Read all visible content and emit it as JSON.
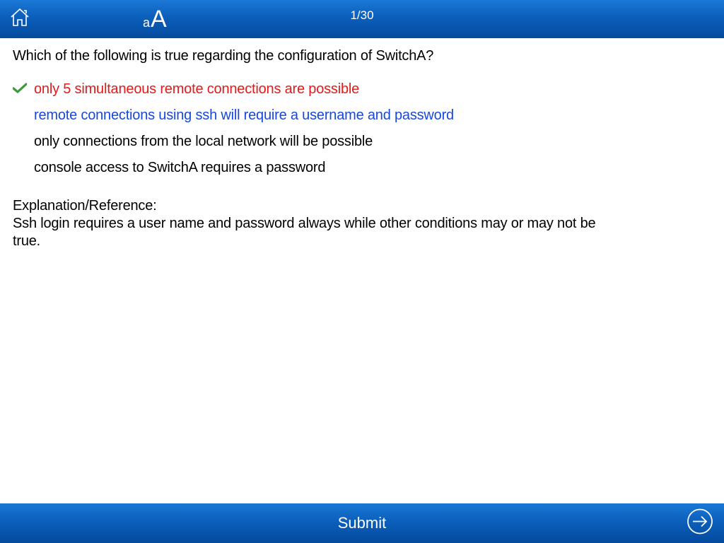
{
  "header": {
    "page_counter": "1/30"
  },
  "question": {
    "text": "Which of the following is true regarding the configuration of SwitchA?"
  },
  "answers": [
    {
      "text": "only 5 simultaneous remote connections are possible",
      "state": "selected-wrong",
      "checked": true
    },
    {
      "text": "remote connections using ssh will require a username and password",
      "state": "correct",
      "checked": false
    },
    {
      "text": "only connections from the local network will be possible",
      "state": "normal",
      "checked": false
    },
    {
      "text": "console access to SwitchA requires a password",
      "state": "normal",
      "checked": false
    }
  ],
  "explanation": {
    "title": "Explanation/Reference:",
    "body": "Ssh login requires a user name and password always while other conditions may or may not be true."
  },
  "footer": {
    "submit_label": "Submit"
  }
}
